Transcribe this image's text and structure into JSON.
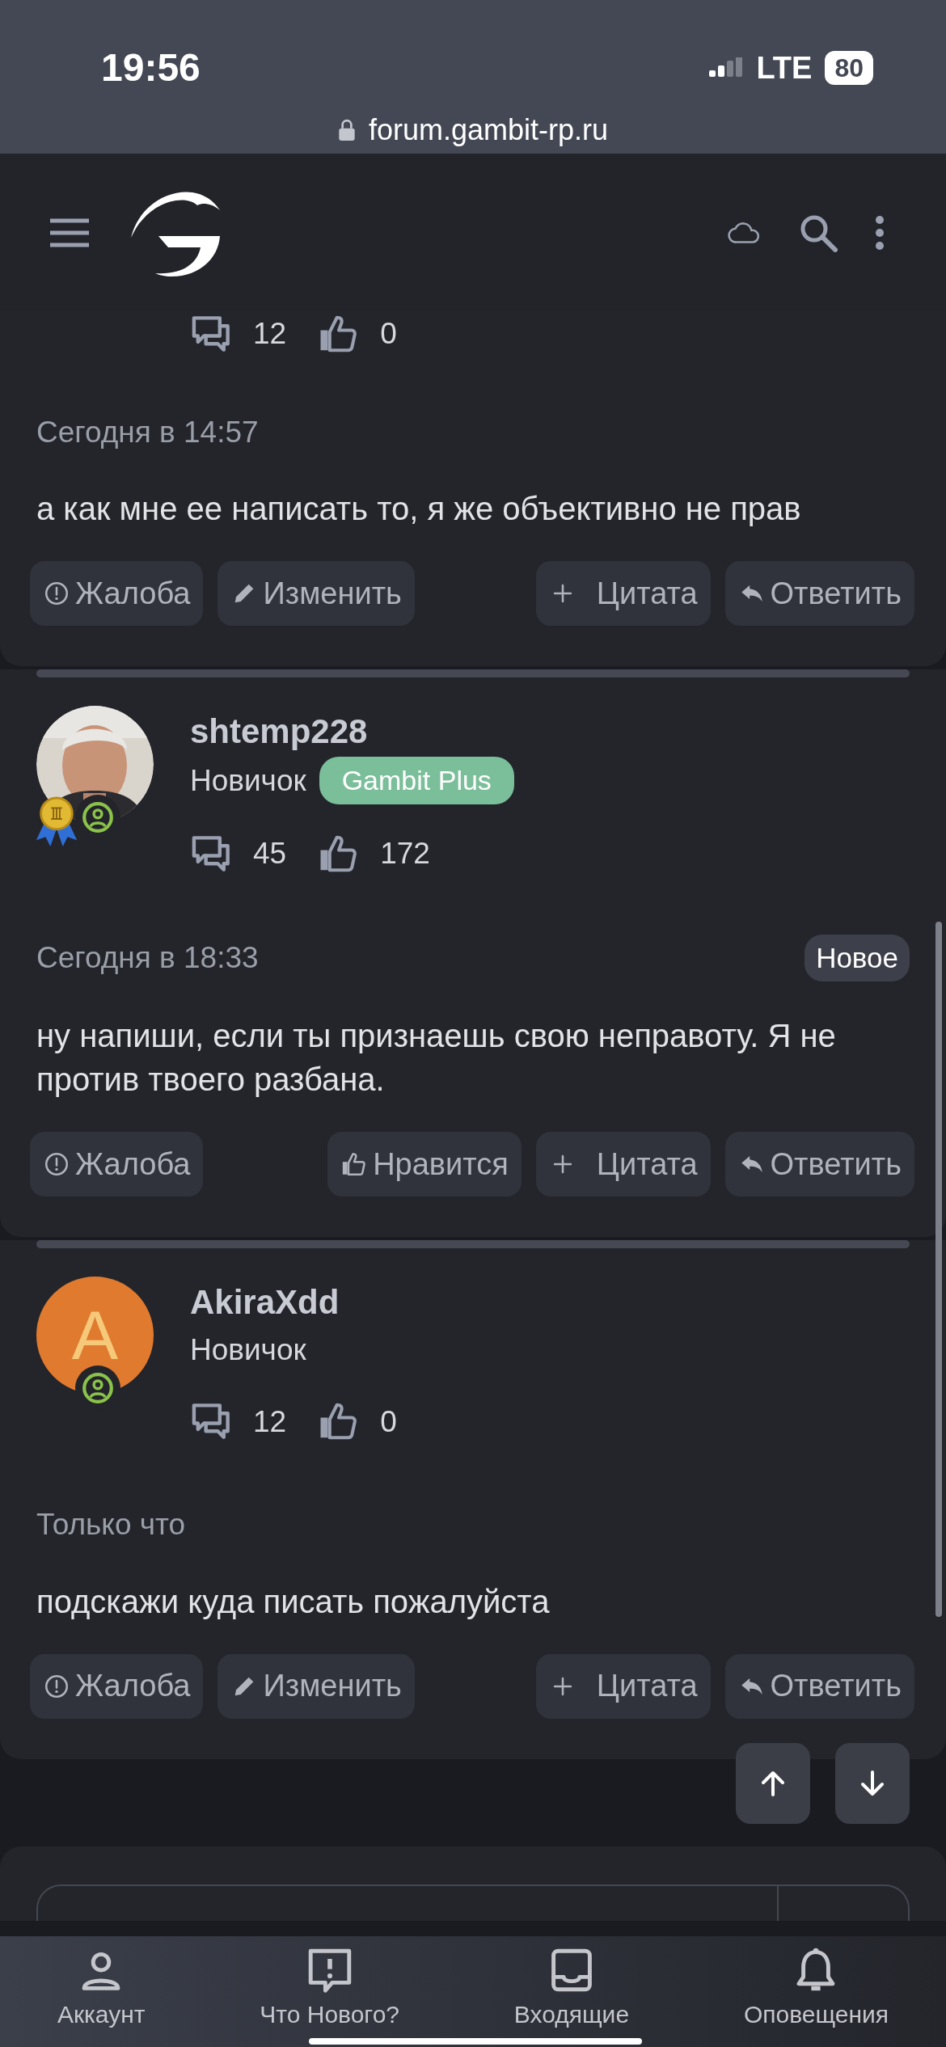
{
  "status_bar": {
    "time": "19:56",
    "network": "LTE",
    "battery": "80"
  },
  "address_bar": {
    "url": "forum.gambit-rp.ru"
  },
  "posts": [
    {
      "stats": {
        "messages": "12",
        "reactions": "0"
      },
      "date": "Сегодня в 14:57",
      "text": "а как мне ее написать то, я же объективно не прав",
      "actions": [
        {
          "kind": "report",
          "label": "Жалоба"
        },
        {
          "kind": "edit",
          "label": "Изменить"
        },
        {
          "kind": "quote",
          "label": "Цитата"
        },
        {
          "kind": "reply",
          "label": "Ответить"
        }
      ]
    },
    {
      "author": {
        "name": "shtemp228",
        "title": "Новичок",
        "banner": "Gambit Plus",
        "award": true,
        "messages": "45",
        "reactions": "172"
      },
      "date": "Сегодня в 18:33",
      "badge": "Новое",
      "text": "ну напиши, если ты признаешь свою неправоту. Я не против твоего разбана.",
      "actions": [
        {
          "kind": "report",
          "label": "Жалоба"
        },
        {
          "kind": "like",
          "label": "Нравится"
        },
        {
          "kind": "quote",
          "label": "Цитата"
        },
        {
          "kind": "reply",
          "label": "Ответить"
        }
      ]
    },
    {
      "author": {
        "name": "AkiraXdd",
        "title": "Новичок",
        "avatar": {
          "kind": "letter",
          "letter": "A",
          "color": "#e07a2e"
        },
        "award": false,
        "messages": "12",
        "reactions": "0"
      },
      "date": "Только что",
      "text": "подскажи куда писать пожалуйста",
      "actions": [
        {
          "kind": "report",
          "label": "Жалоба"
        },
        {
          "kind": "edit",
          "label": "Изменить"
        },
        {
          "kind": "quote",
          "label": "Цитата"
        },
        {
          "kind": "reply",
          "label": "Ответить"
        }
      ]
    }
  ],
  "scroll_buttons": [
    {
      "kind": "up"
    },
    {
      "kind": "down"
    }
  ],
  "bottom_nav": [
    {
      "kind": "account",
      "label": "Аккаунт"
    },
    {
      "kind": "whats_new",
      "label": "Что Нового?"
    },
    {
      "kind": "inbox",
      "label": "Входящие"
    },
    {
      "kind": "alerts",
      "label": "Оповещения"
    }
  ]
}
